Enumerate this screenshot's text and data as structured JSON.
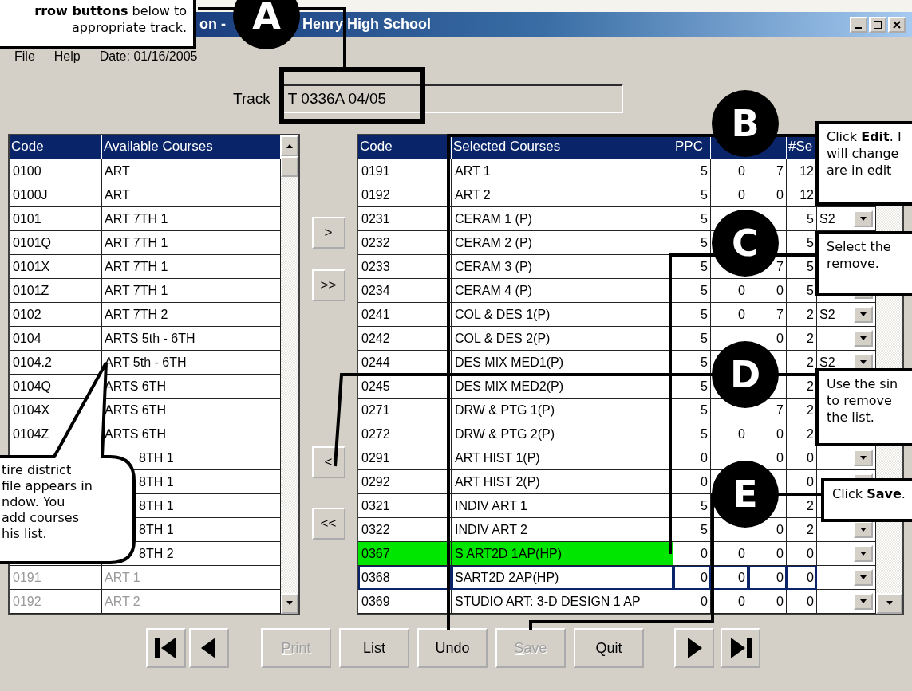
{
  "top_note": {
    "text": "**rrow buttons** below to\nappropriate track."
  },
  "window": {
    "title_left": "on -",
    "title_right": "Henry High School"
  },
  "menu": [
    "File",
    "Help",
    "Date: 01/16/2005"
  ],
  "track": {
    "label": "Track",
    "value": "T 0336A 04/05"
  },
  "available_courses": {
    "columns": [
      "Code",
      "Available Courses"
    ],
    "rows": [
      {
        "kind": "full",
        "code": "0100",
        "name": "ART",
        "disabled": false
      },
      {
        "kind": "full",
        "code": "0100J",
        "name": "ART",
        "disabled": false
      },
      {
        "kind": "full",
        "code": "0101",
        "name": "ART 7TH 1",
        "disabled": false
      },
      {
        "kind": "full",
        "code": "0101Q",
        "name": "ART 7TH 1",
        "disabled": false
      },
      {
        "kind": "full",
        "code": "0101X",
        "name": "ART 7TH 1",
        "disabled": false
      },
      {
        "kind": "full",
        "code": "0101Z",
        "name": "ART 7TH 1",
        "disabled": false
      },
      {
        "kind": "full",
        "code": "0102",
        "name": "ART 7TH 2",
        "disabled": false
      },
      {
        "kind": "full",
        "code": "0104",
        "name": "ARTS 5th - 6TH",
        "disabled": false
      },
      {
        "kind": "full",
        "code": "0104.2",
        "name": "ART 5th - 6TH",
        "disabled": false
      },
      {
        "kind": "full",
        "code": "0104Q",
        "name": "ARTS 6TH",
        "disabled": false
      },
      {
        "kind": "full",
        "code": "0104X",
        "name": "ARTS 6TH",
        "disabled": false
      },
      {
        "kind": "full",
        "code": "0104Z",
        "name": "ARTS 6TH",
        "disabled": false
      },
      {
        "kind": "partial",
        "name": "8TH 1",
        "disabled": false
      },
      {
        "kind": "partial",
        "name": "8TH 1",
        "disabled": false
      },
      {
        "kind": "partial",
        "name": "8TH 1",
        "disabled": false
      },
      {
        "kind": "partial",
        "name": "8TH 1",
        "disabled": false
      },
      {
        "kind": "partial",
        "name": "8TH 2",
        "disabled": false
      },
      {
        "kind": "full",
        "code": "0191",
        "name": "ART 1",
        "disabled": true
      },
      {
        "kind": "full",
        "code": "0192",
        "name": "ART 2",
        "disabled": true
      }
    ],
    "note": "tire district\nfile appears in\nndow. You\nadd courses\nhis list."
  },
  "transfer_buttons": [
    ">",
    ">>",
    "<",
    "<<"
  ],
  "selected_courses": {
    "columns": [
      "Code",
      "Selected Courses",
      "PPC",
      "#Se"
    ],
    "rows": [
      {
        "code": "0191",
        "course": "ART 1",
        "ppc": "5",
        "col_4": "0",
        "col_5": "7",
        "sections": "12",
        "marked": false,
        "selected": false
      },
      {
        "code": "0192",
        "course": "ART 2",
        "ppc": "5",
        "col_4": "0",
        "col_5": "0",
        "sections": "12",
        "marked": false,
        "selected": false
      },
      {
        "code": "0231",
        "course": "CERAM 1 (P)",
        "ppc": "5",
        "sections": "5",
        "term": "S2",
        "marked": false,
        "selected": false
      },
      {
        "code": "0232",
        "course": "CERAM 2 (P)",
        "ppc": "5",
        "sections": "5",
        "marked": false,
        "selected": false
      },
      {
        "code": "0233",
        "course": "CERAM 3 (P)",
        "ppc": "5",
        "col_5": "7",
        "sections": "5",
        "marked": false,
        "selected": false
      },
      {
        "code": "0234",
        "course": "CERAM 4 (P)",
        "ppc": "5",
        "col_4": "0",
        "col_5": "0",
        "sections": "5",
        "marked": false,
        "selected": false
      },
      {
        "code": "0241",
        "course": "COL & DES 1(P)",
        "ppc": "5",
        "col_4": "0",
        "col_5": "7",
        "sections": "2",
        "term": "S2",
        "marked": false,
        "selected": false
      },
      {
        "code": "0242",
        "course": "COL & DES 2(P)",
        "ppc": "5",
        "col_5": "0",
        "sections": "2",
        "marked": false,
        "selected": false
      },
      {
        "code": "0244",
        "course": "DES MIX MED1(P)",
        "ppc": "5",
        "sections": "2",
        "term": "S2",
        "marked": false,
        "selected": false
      },
      {
        "code": "0245",
        "course": "DES MIX MED2(P)",
        "ppc": "5",
        "sections": "2",
        "marked": false,
        "selected": false
      },
      {
        "code": "0271",
        "course": "DRW & PTG 1(P)",
        "ppc": "5",
        "col_5": "7",
        "sections": "2",
        "marked": false,
        "selected": false
      },
      {
        "code": "0272",
        "course": "DRW & PTG 2(P)",
        "ppc": "5",
        "col_4": "0",
        "col_5": "0",
        "sections": "2",
        "marked": false,
        "selected": false
      },
      {
        "code": "0291",
        "course": "ART HIST 1(P)",
        "ppc": "0",
        "col_5": "0",
        "sections": "0",
        "marked": false,
        "selected": false
      },
      {
        "code": "0292",
        "course": "ART HIST 2(P)",
        "ppc": "0",
        "sections": "0",
        "marked": false,
        "selected": false
      },
      {
        "code": "0321",
        "course": "INDIV ART 1",
        "ppc": "5",
        "sections": "2",
        "marked": false,
        "selected": false
      },
      {
        "code": "0322",
        "course": "INDIV ART 2",
        "ppc": "5",
        "col_5": "0",
        "sections": "2",
        "marked": false,
        "selected": false
      },
      {
        "code": "0367",
        "course": "S ART2D 1AP(HP)",
        "ppc": "0",
        "col_4": "0",
        "col_5": "0",
        "sections": "0",
        "marked": true,
        "selected": false
      },
      {
        "code": "0368",
        "course": "SART2D 2AP(HP)",
        "ppc": "0",
        "col_4": "0",
        "col_5": "0",
        "sections": "0",
        "marked": false,
        "selected": true
      },
      {
        "code": "0369",
        "course": "STUDIO ART: 3-D DESIGN 1 AP",
        "ppc": "0",
        "col_4": "0",
        "col_5": "0",
        "sections": "0",
        "marked": false,
        "selected": false
      }
    ]
  },
  "buttons": [
    {
      "kind": "first",
      "disabled": false
    },
    {
      "kind": "prev",
      "disabled": false
    },
    {
      "kind": "text",
      "label": "Print",
      "disabled": true
    },
    {
      "kind": "text",
      "label": "List",
      "disabled": false
    },
    {
      "kind": "text",
      "label": "Undo",
      "disabled": false
    },
    {
      "kind": "text",
      "label": "Save",
      "disabled": true
    },
    {
      "kind": "text",
      "label": "Quit",
      "disabled": false
    },
    {
      "kind": "next",
      "disabled": false
    },
    {
      "kind": "last",
      "disabled": false
    }
  ],
  "steps": [
    {
      "marker": "A"
    },
    {
      "marker": "B",
      "note": "Click **Edit**. I\nwill change\nare in edit"
    },
    {
      "marker": "C",
      "note": "Select the\nremove."
    },
    {
      "marker": "D",
      "note": "Use the sin\nto remove\nthe list."
    },
    {
      "marker": "E",
      "note": "Click **Save**."
    }
  ]
}
